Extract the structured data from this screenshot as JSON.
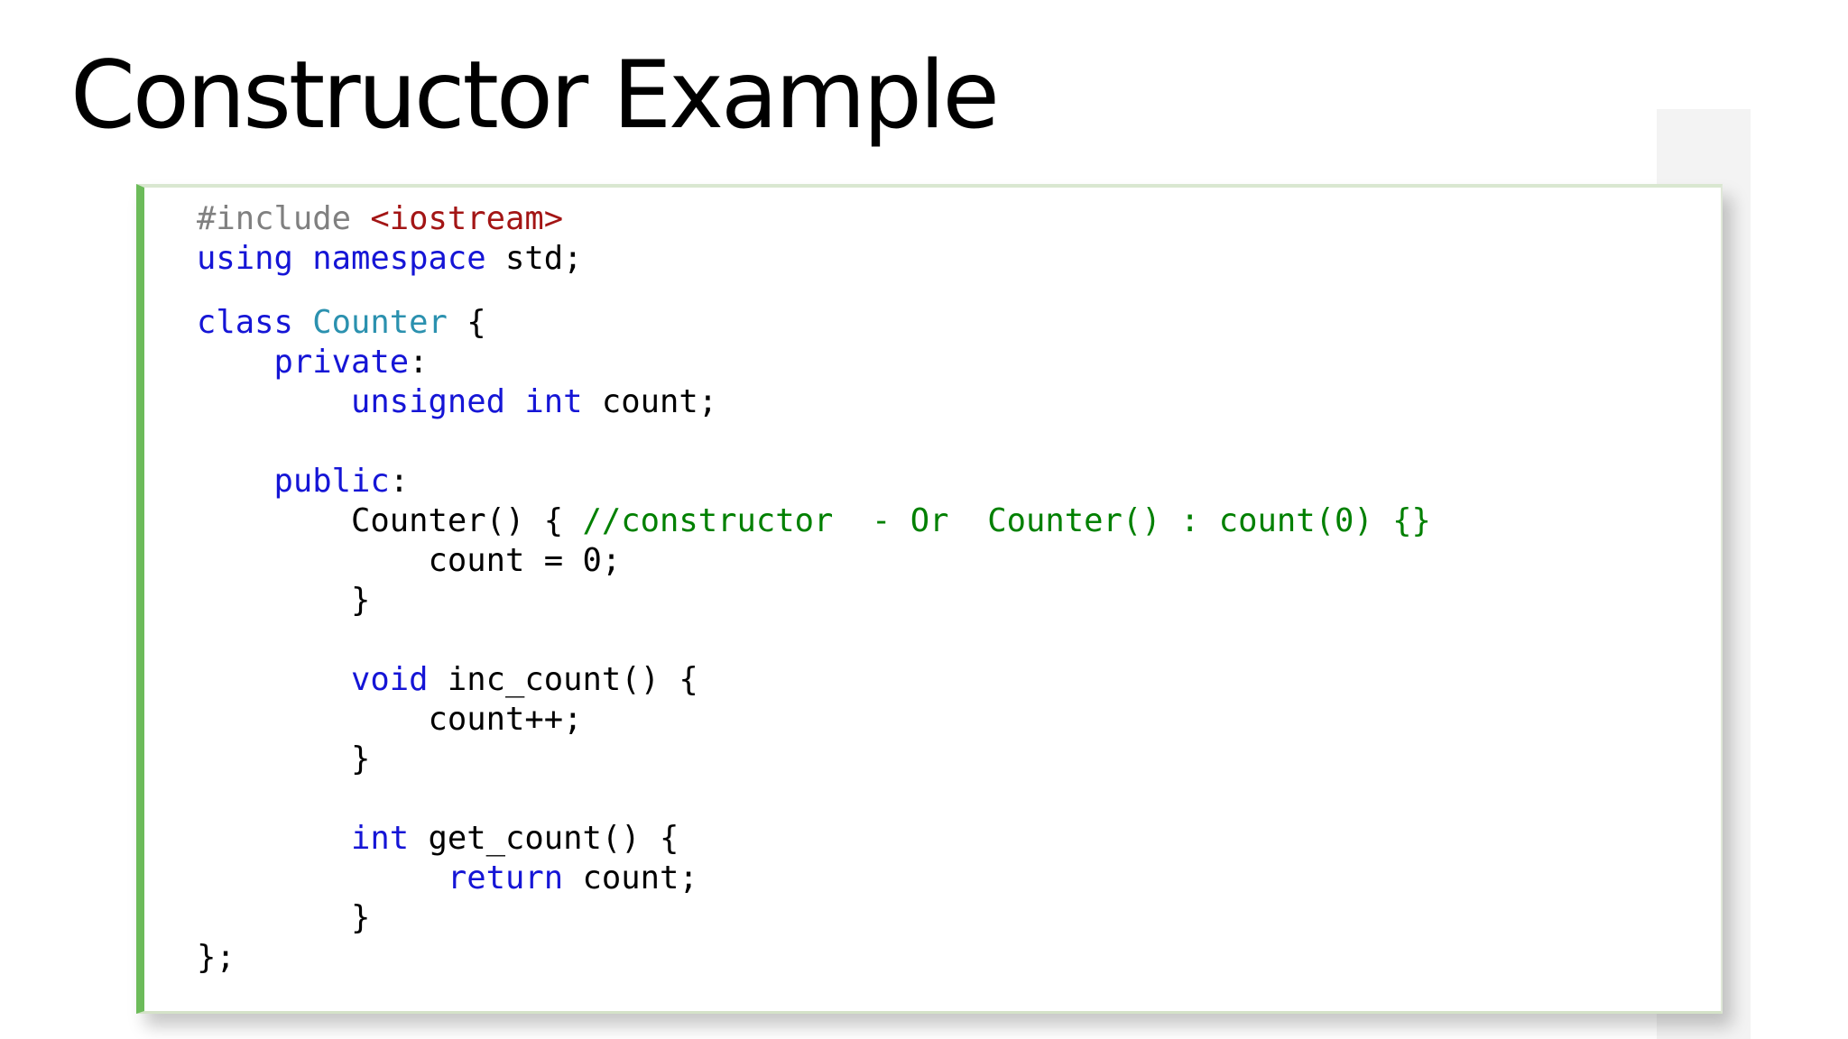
{
  "slide": {
    "title": "Constructor Example"
  },
  "code": {
    "language": "cpp",
    "colors": {
      "keyword": "#1515d6",
      "preprocessor": "#808080",
      "string": "#a31515",
      "type": "#2b91af",
      "comment": "#008000",
      "text": "#000000",
      "accent_bar": "#6cbb5a"
    },
    "lines": [
      [
        [
          "pp",
          "#include "
        ],
        [
          "str",
          "<iostream>"
        ]
      ],
      [
        [
          "kw",
          "using"
        ],
        [
          "tx",
          " "
        ],
        [
          "kw",
          "namespace"
        ],
        [
          "tx",
          " std;"
        ]
      ],
      [
        [
          "kw",
          "class"
        ],
        [
          "tx",
          " "
        ],
        [
          "ty",
          "Counter"
        ],
        [
          "tx",
          " {"
        ]
      ],
      [
        [
          "tx",
          "    "
        ],
        [
          "kw",
          "private"
        ],
        [
          "tx",
          ":"
        ]
      ],
      [
        [
          "tx",
          "        "
        ],
        [
          "kw",
          "unsigned"
        ],
        [
          "tx",
          " "
        ],
        [
          "kw",
          "int"
        ],
        [
          "tx",
          " count;"
        ]
      ],
      [
        [
          "tx",
          "    "
        ],
        [
          "kw",
          "public"
        ],
        [
          "tx",
          ":"
        ]
      ],
      [
        [
          "tx",
          "        Counter() { "
        ],
        [
          "cm",
          "//constructor  - Or  Counter() : count(0) {}"
        ]
      ],
      [
        [
          "tx",
          "            count = 0;"
        ]
      ],
      [
        [
          "tx",
          "        }"
        ]
      ],
      [
        [
          "tx",
          "        "
        ],
        [
          "kw",
          "void"
        ],
        [
          "tx",
          " inc_count() {"
        ]
      ],
      [
        [
          "tx",
          "            count++;"
        ]
      ],
      [
        [
          "tx",
          "        }"
        ]
      ],
      [
        [
          "tx",
          "        "
        ],
        [
          "kw",
          "int"
        ],
        [
          "tx",
          " get_count() {"
        ]
      ],
      [
        [
          "tx",
          "             "
        ],
        [
          "kw",
          "return"
        ],
        [
          "tx",
          " count;"
        ]
      ],
      [
        [
          "tx",
          "        }"
        ]
      ],
      [
        [
          "tx",
          "};"
        ]
      ]
    ]
  }
}
